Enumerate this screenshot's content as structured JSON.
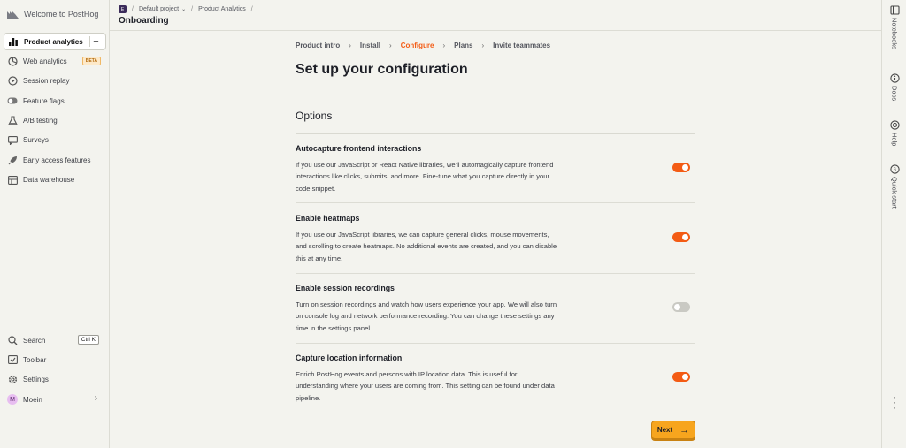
{
  "sidebar": {
    "brand": "Welcome to PostHog",
    "items": [
      {
        "label": "Product analytics",
        "icon": "bar-chart-icon"
      },
      {
        "label": "Web analytics",
        "icon": "pie-chart-icon",
        "badge": "BETA"
      },
      {
        "label": "Session replay",
        "icon": "play-circle-icon"
      },
      {
        "label": "Feature flags",
        "icon": "toggle-icon"
      },
      {
        "label": "A/B testing",
        "icon": "flask-icon"
      },
      {
        "label": "Surveys",
        "icon": "chat-icon"
      },
      {
        "label": "Early access features",
        "icon": "rocket-icon"
      },
      {
        "label": "Data warehouse",
        "icon": "database-icon"
      }
    ],
    "bottom": {
      "search": "Search",
      "search_shortcut": "Ctrl K",
      "toolbar": "Toolbar",
      "settings": "Settings",
      "user_initial": "M",
      "user_name": "Moein"
    }
  },
  "topbar": {
    "project_badge": "E",
    "project": "Default project",
    "section": "Product Analytics",
    "title": "Onboarding"
  },
  "steps": [
    "Product intro",
    "Install",
    "Configure",
    "Plans",
    "Invite teammates"
  ],
  "current_step": "Configure",
  "heading": "Set up your configuration",
  "options_title": "Options",
  "options": [
    {
      "title": "Autocapture frontend interactions",
      "desc": "If you use our JavaScript or React Native libraries, we'll automagically capture frontend interactions like clicks, submits, and more. Fine-tune what you capture directly in your code snippet.",
      "enabled": true
    },
    {
      "title": "Enable heatmaps",
      "desc": "If you use our JavaScript libraries, we can capture general clicks, mouse movements, and scrolling to create heatmaps. No additional events are created, and you can disable this at any time.",
      "enabled": true
    },
    {
      "title": "Enable session recordings",
      "desc": "Turn on session recordings and watch how users experience your app. We will also turn on console log and network performance recording. You can change these settings any time in the settings panel.",
      "enabled": false
    },
    {
      "title": "Capture location information",
      "desc": "Enrich PostHog events and persons with IP location data. This is useful for understanding where your users are coming from. This setting can be found under data pipeline.",
      "enabled": true
    }
  ],
  "next_label": "Next",
  "rail": [
    "Notebooks",
    "Docs",
    "Help",
    "Quick start"
  ],
  "colors": {
    "accent": "#f35b14",
    "button": "#f7a51e",
    "background": "#f3f3ee"
  }
}
